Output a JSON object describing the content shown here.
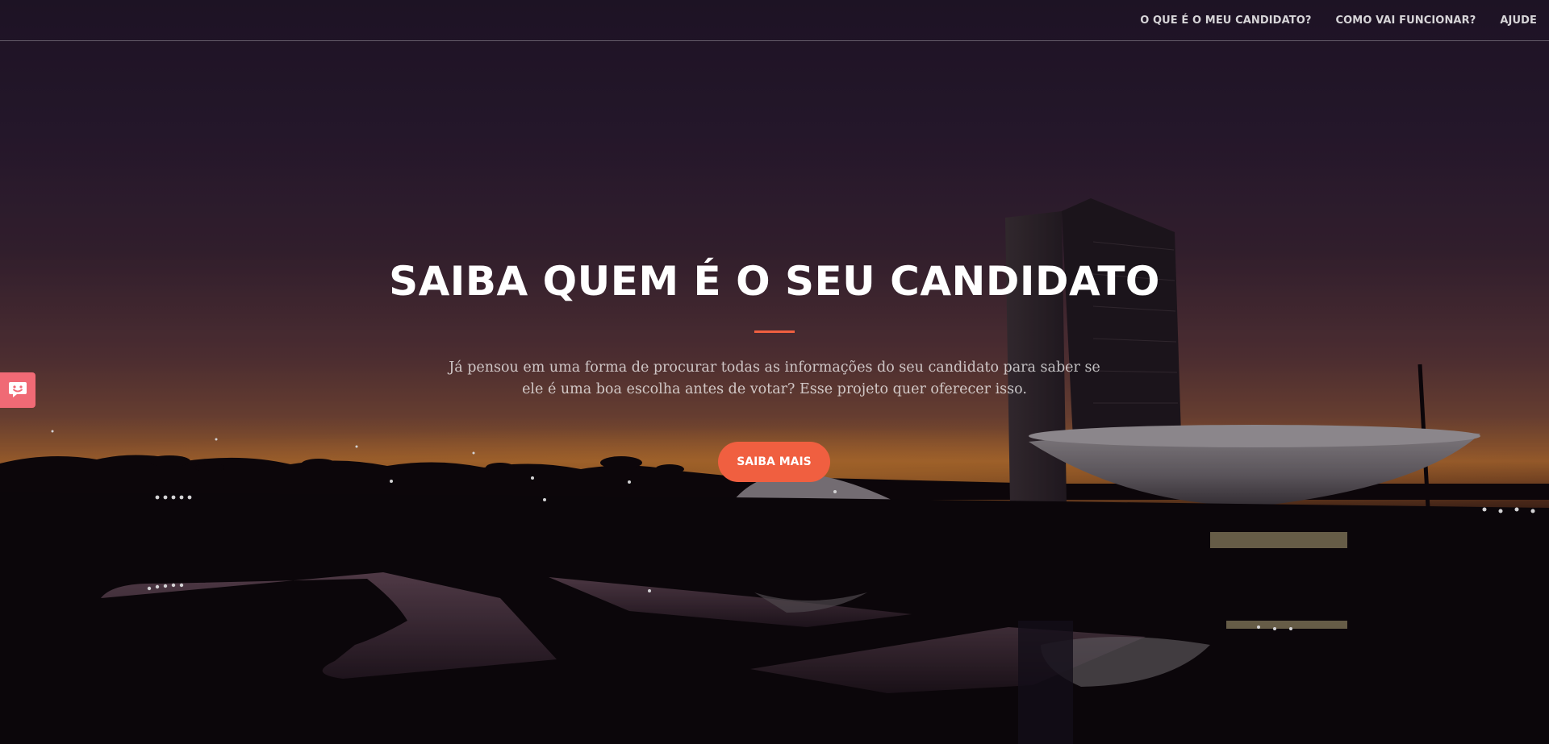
{
  "nav": {
    "items": [
      {
        "label": "O QUE É O MEU CANDIDATO?"
      },
      {
        "label": "COMO VAI FUNCIONAR?"
      },
      {
        "label": "AJUDE"
      }
    ]
  },
  "hero": {
    "headline": "SAIBA QUEM É O SEU CANDIDATO",
    "subtext": "Já pensou em uma forma de procurar todas as informações do seu candidato para saber se ele é uma boa escolha antes de votar? Esse projeto quer oferecer isso.",
    "cta_label": "SAIBA MAIS"
  },
  "colors": {
    "accent": "#f05f40",
    "feedback_tab": "#f06a75",
    "text": "#ffffff"
  },
  "icons": {
    "feedback": "chat-bubble-smile-icon"
  }
}
